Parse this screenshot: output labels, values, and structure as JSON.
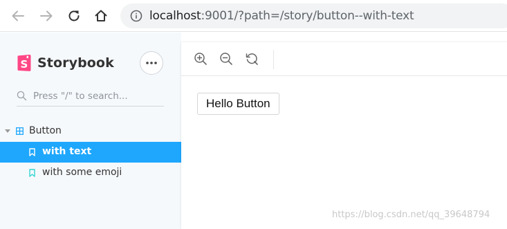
{
  "browser": {
    "url_host": "localhost",
    "url_rest": ":9001/?path=/story/button--with-text",
    "icons": [
      "back-arrow-icon",
      "forward-arrow-icon",
      "reload-icon",
      "home-icon",
      "info-icon"
    ]
  },
  "sidebar": {
    "brand": "Storybook",
    "brand_color": "#ff4785",
    "search_placeholder": "Press \"/\" to search...",
    "group": {
      "label": "Button",
      "expanded": true
    },
    "stories": [
      {
        "label": "with text",
        "selected": true
      },
      {
        "label": "with some emoji",
        "selected": false
      }
    ],
    "selected_color": "#1ea7fd"
  },
  "preview": {
    "tools": [
      "zoom-in-icon",
      "zoom-out-icon",
      "zoom-reset-icon"
    ],
    "button_label": "Hello Button",
    "watermark": "https://blog.csdn.net/qq_39648794"
  }
}
